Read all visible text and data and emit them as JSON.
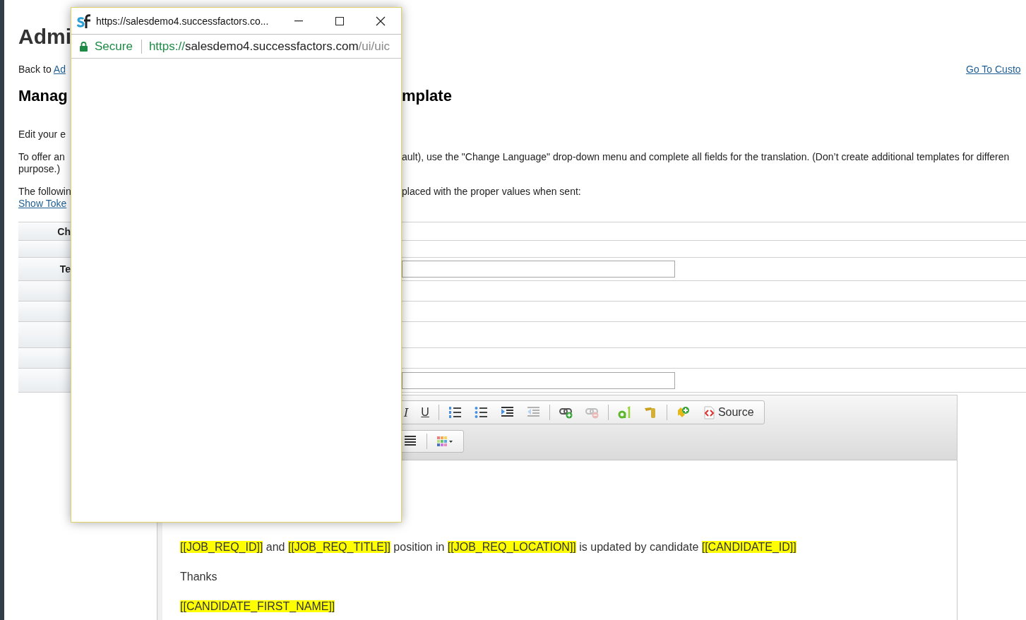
{
  "page": {
    "title": "Admi",
    "back_prefix": "Back to",
    "back_link": "Ad",
    "go_link": "Go To Custo",
    "heading_left": "Manag",
    "heading_right": "mplate",
    "intro": [
      {
        "left": "Edit your e"
      },
      {
        "left": "To offer an",
        "right": "ault), use the \"Change Language\" drop-down menu and complete all fields for the translation. (Don’t create additional templates for differen",
        "line2": "purpose.)"
      },
      {
        "left": "The followin",
        "right": "placed with the proper values when sent:",
        "link": "Show Toke"
      }
    ]
  },
  "form_rows": [
    {
      "label": "Ch",
      "kind": "plain"
    },
    {
      "kind": "plain"
    },
    {
      "label": "Te",
      "kind": "input"
    },
    {
      "kind": "plain"
    },
    {
      "kind": "plain"
    },
    {
      "kind": "plain"
    },
    {
      "kind": "plain"
    },
    {
      "kind": "input"
    }
  ],
  "editor": {
    "toolbar": [
      {
        "items": [
          {
            "kind": "italic",
            "label": "I",
            "disabled": false
          },
          {
            "kind": "underline",
            "label": "U",
            "disabled": false
          },
          {
            "kind": "separator"
          },
          {
            "kind": "numbered-list",
            "disabled": false
          },
          {
            "kind": "bulleted-list",
            "disabled": false
          },
          {
            "kind": "indent",
            "disabled": false
          },
          {
            "kind": "outdent",
            "disabled": true
          },
          {
            "kind": "separator"
          },
          {
            "kind": "link",
            "disabled": false
          },
          {
            "kind": "unlink",
            "disabled": true
          },
          {
            "kind": "separator"
          },
          {
            "kind": "spellcheck",
            "disabled": false
          },
          {
            "kind": "hammer",
            "disabled": false
          },
          {
            "kind": "separator"
          },
          {
            "kind": "add-token",
            "disabled": false
          },
          {
            "kind": "source",
            "label": "Source",
            "disabled": false
          }
        ]
      },
      {
        "items": [
          {
            "kind": "justify",
            "disabled": false
          },
          {
            "kind": "separator"
          },
          {
            "kind": "color-grid",
            "disabled": false
          }
        ]
      }
    ],
    "body": [
      [
        {
          "text": "[[JOB_REQ_ID]]",
          "token": true
        },
        {
          "text": " and  ",
          "token": false
        },
        {
          "text": "[[JOB_REQ_TITLE]]",
          "token": true
        },
        {
          "text": " position in ",
          "token": false
        },
        {
          "text": "[[JOB_REQ_LOCATION]]",
          "token": true
        },
        {
          "text": " is updated by candidate ",
          "token": false
        },
        {
          "text": "[[CANDIDATE_ID]]",
          "token": true
        }
      ],
      [
        {
          "text": "Thanks",
          "token": false
        }
      ],
      [
        {
          "text": "[[CANDIDATE_FIRST_NAME]]",
          "token": true
        }
      ]
    ]
  },
  "popup": {
    "title": "https://salesdemo4.successfactors.co...",
    "security": "Secure",
    "url_scheme": "https://",
    "url_host": "salesdemo4.successfactors.com",
    "url_path": "/ui/uic"
  }
}
